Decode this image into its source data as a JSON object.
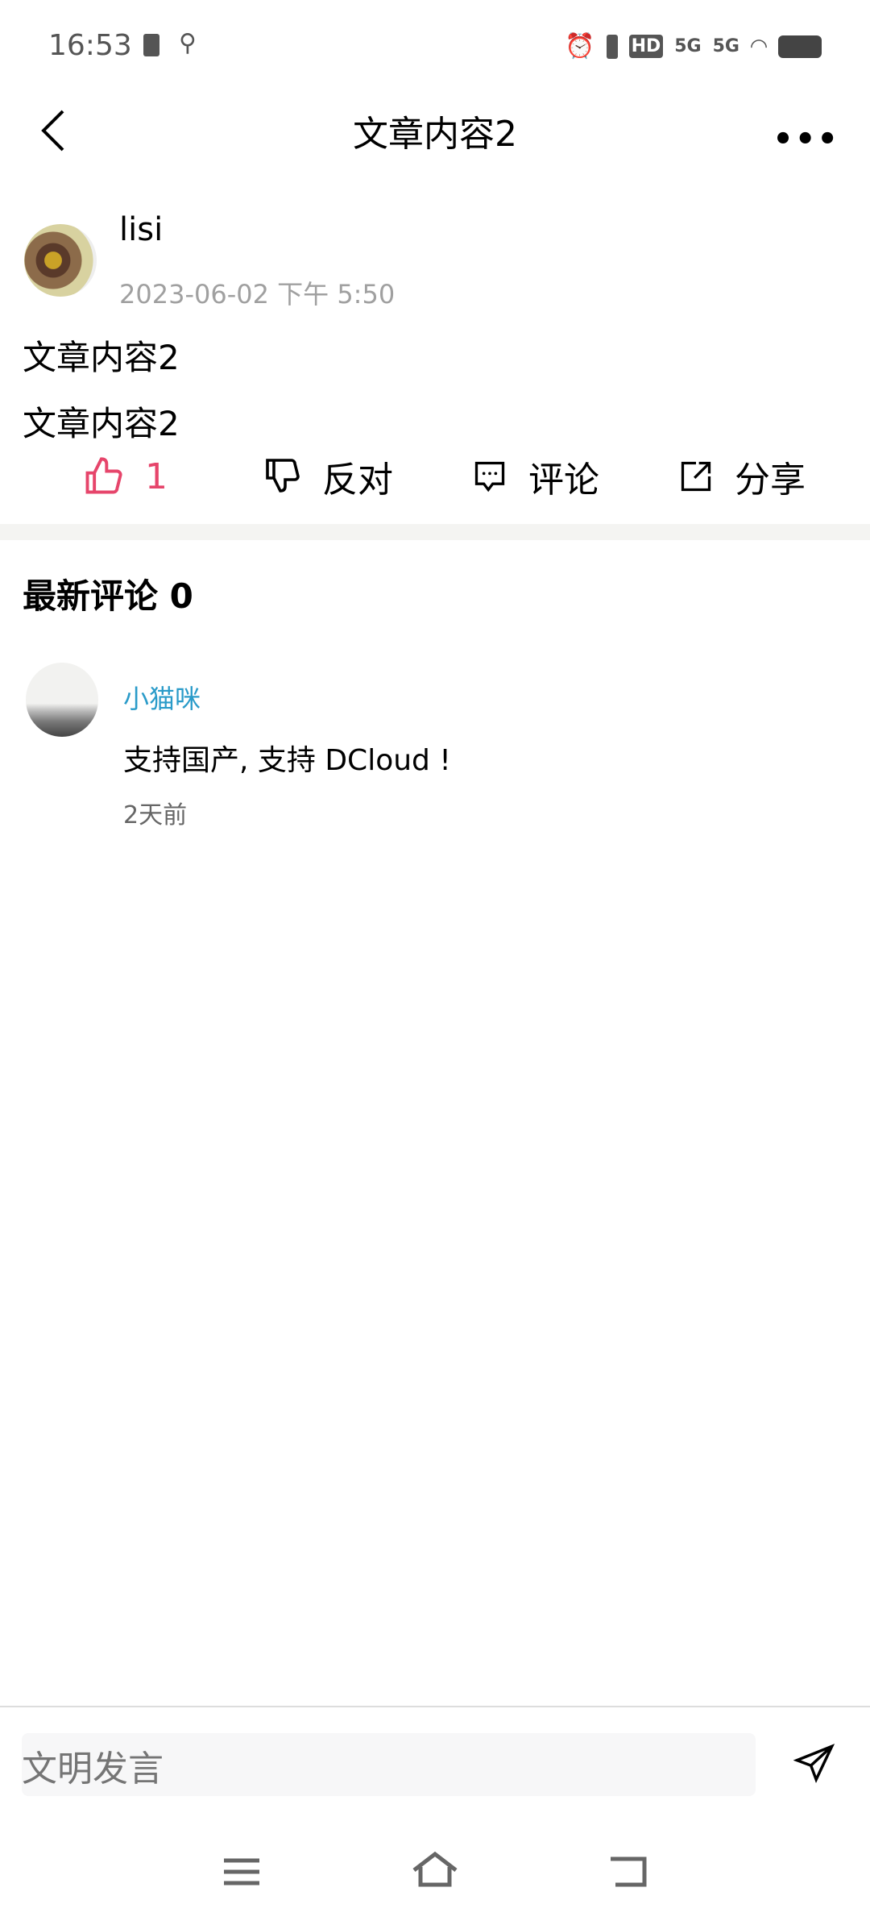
{
  "status_bar": {
    "time": "16:53",
    "icons": [
      "clipboard-check-icon",
      "usb-icon",
      "alarm-icon",
      "vibrate-icon",
      "hd-icon",
      "signal-5g-icon",
      "signal-5g-icon",
      "wifi-icon",
      "battery-icon"
    ],
    "net1": "5G",
    "net2": "5G",
    "hd": "HD"
  },
  "header": {
    "title": "文章内容2",
    "more_icon": "more-icon",
    "back_icon": "back-icon"
  },
  "post": {
    "author": "lisi",
    "date": "2023-06-02 下午 5:50",
    "lines": [
      "文章内容2",
      "文章内容2"
    ]
  },
  "actions": {
    "like_count": "1",
    "oppose": "反对",
    "comment": "评论",
    "share": "分享",
    "like_color": "#e6456b"
  },
  "comments": {
    "title": "最新评论 0",
    "items": [
      {
        "name": "小猫咪",
        "text": "支持国产, 支持 DCloud !",
        "time": "2天前"
      }
    ]
  },
  "input": {
    "placeholder": "文明发言"
  }
}
